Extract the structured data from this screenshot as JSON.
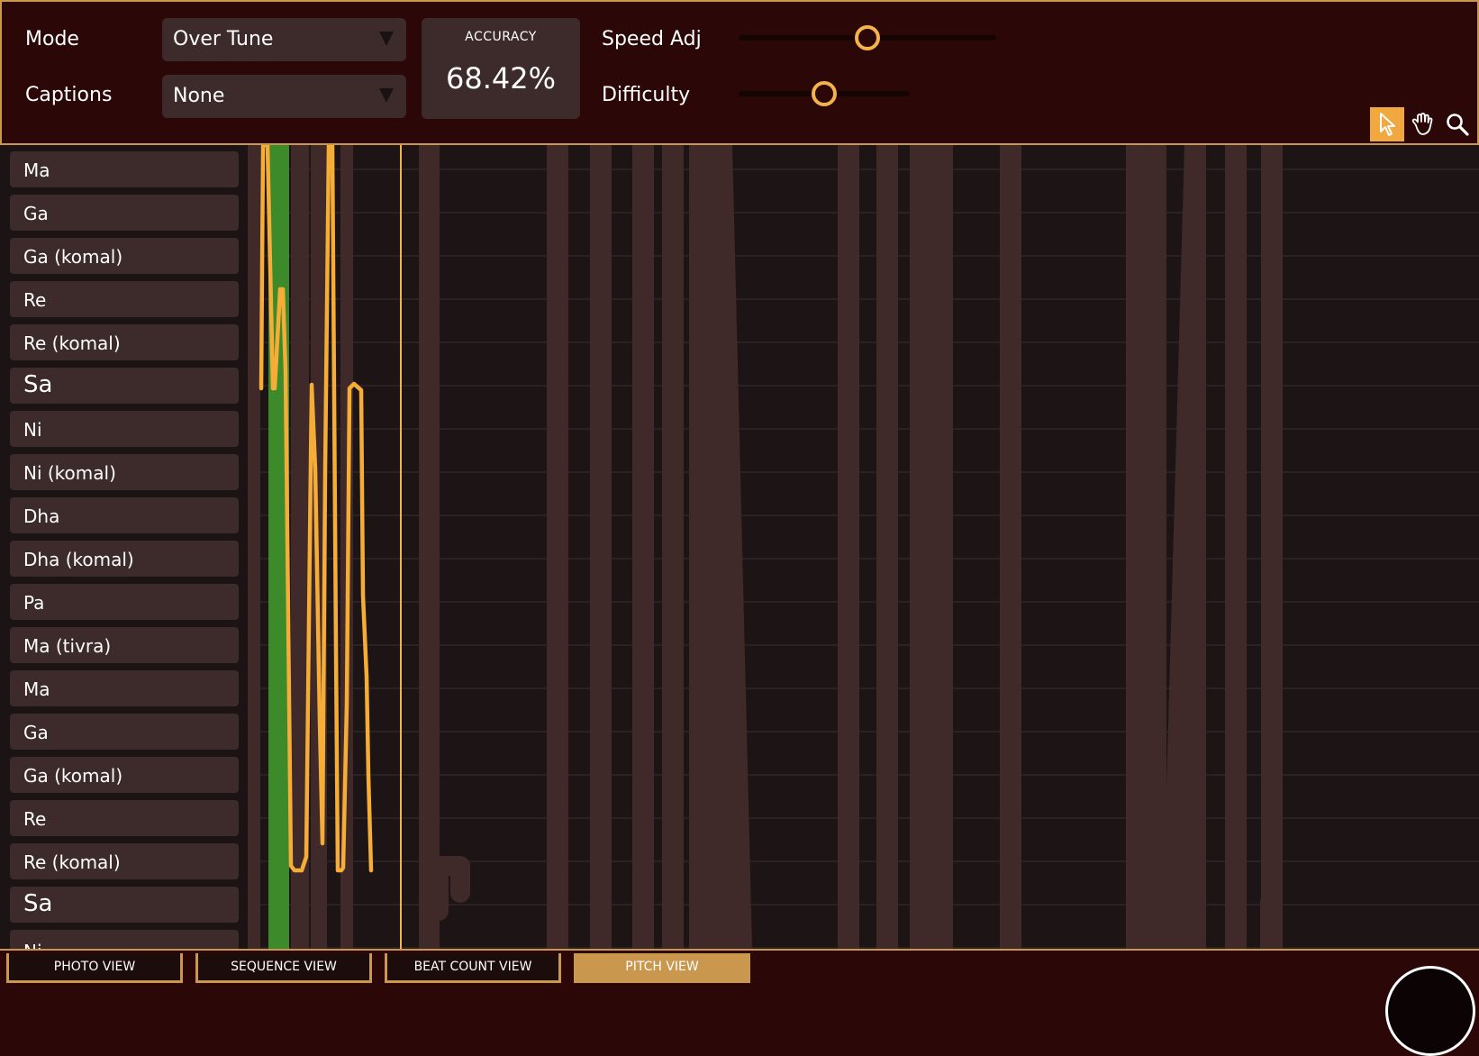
{
  "topbar": {
    "mode_label": "Mode",
    "mode_value": "Over Tune",
    "captions_label": "Captions",
    "captions_value": "None",
    "accuracy_label": "ACCURACY",
    "accuracy_value": "68.42%",
    "speed_label": "Speed Adj",
    "speed_level": 0.5,
    "difficulty_label": "Difficulty",
    "difficulty_level": 0.5,
    "tools": [
      "cursor-icon",
      "hand-icon",
      "magnifier-icon"
    ],
    "active_tool": "cursor-icon"
  },
  "notes": [
    "Ma",
    "Ga",
    "Ga (komal)",
    "Re",
    "Re (komal)",
    "Sa",
    "Ni",
    "Ni (komal)",
    "Dha",
    "Dha (komal)",
    "Pa",
    "Ma (tivra)",
    "Ma",
    "Ga",
    "Ga (komal)",
    "Re",
    "Re (komal)",
    "Sa",
    "Ni"
  ],
  "tabs": [
    "PHOTO VIEW",
    "SEQUENCE VIEW",
    "BEAT COUNT VIEW",
    "PITCH VIEW"
  ],
  "active_tab": "PITCH VIEW",
  "colors": {
    "accent": "#f3b24a",
    "header_bg": "#2c0707",
    "panel": "#3d2a2a",
    "pitch_line": "#f5ad38",
    "target_bar": "#3d8a2a",
    "phrase_bar": "#3f2929"
  }
}
